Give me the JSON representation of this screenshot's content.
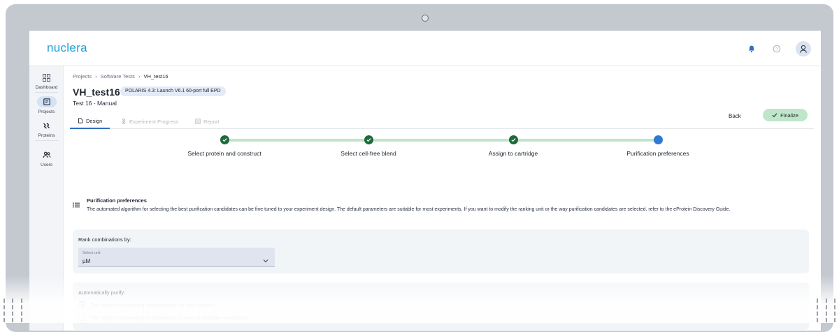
{
  "app": {
    "logo": "nuclera"
  },
  "sidebar": {
    "items": [
      {
        "label": "Dashboard",
        "icon": "dashboard-icon",
        "active": false
      },
      {
        "label": "Projects",
        "icon": "projects-icon",
        "active": true
      },
      {
        "label": "Proteins",
        "icon": "proteins-icon",
        "active": false
      },
      {
        "label": "Users",
        "icon": "users-icon",
        "active": false
      }
    ]
  },
  "breadcrumb": [
    "Projects",
    "Software Tests",
    "VH_test16"
  ],
  "header": {
    "title": "VH_test16",
    "badge": "POLARIS 4.3: Launch V6.1 60-port full EPD",
    "subtitle": "Test 16 - Manual"
  },
  "tabs": [
    {
      "label": "Design",
      "active": true
    },
    {
      "label": "Experiment Progress",
      "active": false
    },
    {
      "label": "Report",
      "active": false
    }
  ],
  "actions": {
    "back": "Back",
    "finalize": "Finalize"
  },
  "steps": [
    {
      "label": "Select protein and construct",
      "state": "done"
    },
    {
      "label": "Select cell-free blend",
      "state": "done"
    },
    {
      "label": "Assign to cartridge",
      "state": "done"
    },
    {
      "label": "Purification preferences",
      "state": "current"
    }
  ],
  "section": {
    "title": "Purification preferences",
    "description": "The automated algorithm for selecting the best purification candidates can be fine tuned to your experiment design. The default parameters are suitable for most experiments. If you want to modify the ranking unit or the way purification candidates are selected, refer to the eProtein Discovery Guide."
  },
  "rank": {
    "label": "Rank combinations by:",
    "placeholder": "Select unit",
    "value": "µM"
  },
  "purify": {
    "label": "Automatically purify:",
    "options": [
      {
        "label": "The highest expressing combinations for each protein.",
        "selected": true
      },
      {
        "label": "The highest expressing combinations across all possible candidates.",
        "selected": false
      }
    ]
  },
  "colors": {
    "accent": "#2f6fc0",
    "brand": "#1aa1d6",
    "success": "#1c6b3a",
    "success_light": "#bfe6c9"
  }
}
